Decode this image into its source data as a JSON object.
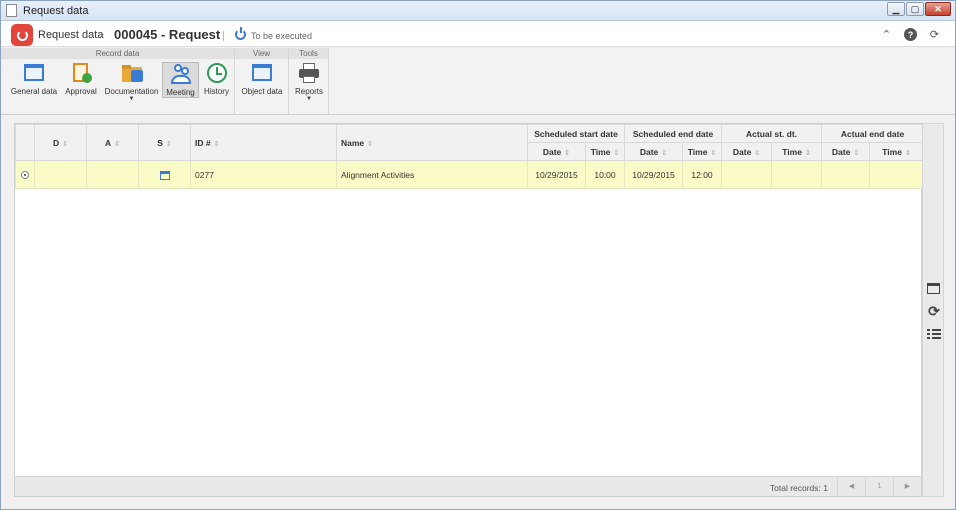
{
  "window": {
    "title": "Request data"
  },
  "header": {
    "crumb1": "Request data",
    "crumb2": "000045 - Request",
    "status": "To be executed"
  },
  "ribbon": {
    "groups": [
      {
        "label": "Record data"
      },
      {
        "label": "View"
      },
      {
        "label": "Tools"
      }
    ],
    "buttons": {
      "general_data": "General data",
      "approval": "Approval",
      "documentation": "Documentation",
      "meeting": "Meeting",
      "history": "History",
      "object_data": "Object data",
      "reports": "Reports"
    }
  },
  "grid": {
    "columns": {
      "d": "D",
      "a": "A",
      "s": "S",
      "id": "ID #",
      "name": "Name",
      "sched_start": "Scheduled start date",
      "sched_end": "Scheduled end date",
      "actual_start": "Actual st. dt.",
      "actual_end": "Actual end date",
      "date": "Date",
      "time": "Time"
    },
    "rows": [
      {
        "id": "0277",
        "name": "Alignment Activities",
        "sched_start_date": "10/29/2015",
        "sched_start_time": "10:00",
        "sched_end_date": "10/29/2015",
        "sched_end_time": "12:00",
        "actual_start_date": "",
        "actual_start_time": "",
        "actual_end_date": "",
        "actual_end_time": ""
      }
    ],
    "total_records": "Total records: 1",
    "page": "1"
  },
  "colors": {
    "accent": "#3a7bd5",
    "brand": "#e2453c",
    "selected_row": "#fbfbc8"
  }
}
